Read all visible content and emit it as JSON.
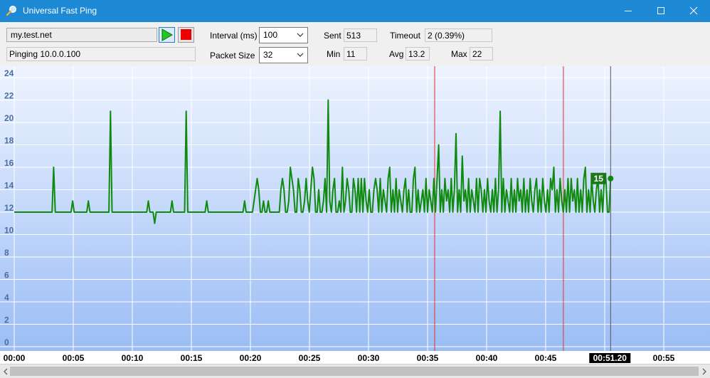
{
  "window": {
    "title": "Universal Fast Ping"
  },
  "icons": {
    "app": "magnifier-icon",
    "minimize": "minimize-icon",
    "maximize": "maximize-icon",
    "close": "close-icon",
    "start": "play-icon",
    "stop": "stop-icon"
  },
  "colors": {
    "titlebar": "#1e8ad6",
    "line": "#0f8a0f",
    "marker": "#e23b3b",
    "badge": "#1a7a1a"
  },
  "controls": {
    "host": "my.test.net",
    "status": "Pinging 10.0.0.100",
    "interval_label": "Interval (ms)",
    "interval_value": "100",
    "packet_label": "Packet Size",
    "packet_value": "32",
    "sent_label": "Sent",
    "sent_value": "513",
    "timeout_label": "Timeout",
    "timeout_value": "2 (0.39%)",
    "min_label": "Min",
    "min_value": "11",
    "avg_label": "Avg",
    "avg_value": "13.2",
    "max_label": "Max",
    "max_value": "22"
  },
  "chart_data": {
    "type": "line",
    "y_ticks": [
      "0",
      "2",
      "4",
      "6",
      "8",
      "10",
      "12",
      "14",
      "16",
      "18",
      "20",
      "22",
      "24"
    ],
    "x_ticks": [
      "00:00",
      "00:05",
      "00:10",
      "00:15",
      "00:20",
      "00:25",
      "00:30",
      "00:35",
      "00:40",
      "00:45",
      "00:50",
      "00:55"
    ],
    "ylim": [
      0,
      25
    ],
    "xlim": [
      0,
      59.6
    ],
    "grid": true,
    "current_label": "15",
    "current_value": 15,
    "cursor_time": "00:51.20",
    "cursor_x": 50.5,
    "timeout_markers": [
      35.6,
      46.5
    ],
    "series": [
      {
        "values": [
          12,
          12,
          12,
          12,
          12,
          12,
          12,
          12,
          12,
          12,
          12,
          12,
          12,
          12,
          12,
          12,
          12,
          12,
          12,
          12,
          12,
          12,
          12,
          12,
          12,
          16,
          12,
          12,
          12,
          12,
          12,
          12,
          12,
          12,
          12,
          12,
          12,
          13,
          12,
          12,
          12,
          12,
          12,
          12,
          12,
          12,
          12,
          13,
          12,
          12,
          12,
          12,
          12,
          12,
          12,
          12,
          12,
          12,
          12,
          12,
          12,
          21,
          12,
          12,
          12,
          12,
          12,
          12,
          12,
          12,
          12,
          12,
          12,
          12,
          12,
          12,
          12,
          12,
          12,
          12,
          12,
          12,
          12,
          12,
          12,
          13,
          12,
          12,
          12,
          11,
          12,
          12,
          12,
          12,
          12,
          12,
          12,
          12,
          12,
          12,
          13,
          12,
          12,
          12,
          12,
          12,
          12,
          12,
          12,
          21,
          12,
          12,
          12,
          12,
          12,
          12,
          12,
          12,
          12,
          12,
          12,
          12,
          13,
          12,
          12,
          12,
          12,
          12,
          12,
          12,
          12,
          12,
          12,
          12,
          12,
          12,
          12,
          12,
          12,
          12,
          12,
          12,
          12,
          12,
          12,
          12,
          13,
          12,
          12,
          12,
          12,
          12,
          13,
          14,
          15,
          14,
          12,
          12,
          13,
          12,
          12,
          13,
          12,
          12,
          12,
          12,
          12,
          12,
          12,
          14,
          15,
          14,
          12,
          12,
          13,
          16,
          15,
          14,
          12,
          12,
          15,
          14,
          12,
          12,
          13,
          15,
          13,
          12,
          14,
          16,
          15,
          12,
          12,
          14,
          12,
          12,
          13,
          15,
          12,
          22,
          13,
          12,
          14,
          15,
          12,
          12,
          13,
          12,
          16,
          12,
          13,
          15,
          14,
          12,
          12,
          15,
          14,
          12,
          15,
          12,
          15,
          12,
          15,
          13,
          12,
          14,
          12,
          12,
          14,
          15,
          14,
          12,
          15,
          12,
          14,
          13,
          12,
          15,
          16,
          12,
          14,
          12,
          15,
          12,
          14,
          13,
          12,
          14,
          15,
          12,
          14,
          12,
          12,
          15,
          16,
          12,
          14,
          12,
          13,
          14,
          12,
          15,
          12,
          14,
          13,
          12,
          15,
          12,
          15,
          18,
          12,
          14,
          12,
          15,
          13,
          14,
          12,
          15,
          12,
          14,
          19,
          12,
          14,
          12,
          17,
          13,
          14,
          12,
          15,
          12,
          14,
          13,
          12,
          15,
          12,
          15,
          14,
          12,
          14,
          12,
          15,
          13,
          12,
          14,
          12,
          15,
          12,
          14,
          21,
          12,
          15,
          12,
          14,
          13,
          12,
          15,
          12,
          14,
          12,
          15,
          13,
          14,
          12,
          15,
          12,
          14,
          12,
          15,
          13,
          12,
          14,
          15,
          12,
          14,
          12,
          15,
          13,
          12,
          14,
          12,
          15,
          14,
          16,
          12,
          14,
          12,
          15,
          13,
          12,
          14,
          12,
          15,
          12,
          15,
          13,
          14,
          12,
          15,
          12,
          14,
          12,
          15,
          16,
          12,
          14,
          12,
          15,
          13,
          12,
          14,
          15,
          12,
          14,
          12,
          15,
          15,
          12,
          12,
          15
        ]
      }
    ]
  }
}
